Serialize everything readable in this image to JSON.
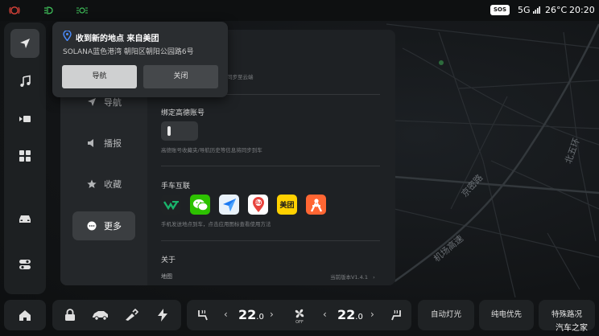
{
  "status_bar": {
    "sos": "SOS",
    "network": "5G",
    "temperature": "26°C",
    "time": "20:20"
  },
  "rail": {
    "items": [
      {
        "name": "navigation",
        "icon": "navigation-arrow-icon",
        "active": true
      },
      {
        "name": "music",
        "icon": "music-note-icon",
        "active": false
      },
      {
        "name": "video",
        "icon": "video-icon",
        "active": false
      },
      {
        "name": "apps",
        "icon": "grid-apps-icon",
        "active": false
      },
      {
        "name": "vehicle",
        "icon": "car-icon",
        "active": false
      },
      {
        "name": "controls",
        "icon": "toggle-controls-icon",
        "active": false
      }
    ]
  },
  "popup": {
    "title": "收到新的地点 来自美团",
    "address": "SOLANA蓝色港湾 朝阳区朝阳公园路6号",
    "navigate_label": "导航",
    "close_label": "关闭"
  },
  "settings": {
    "side_items": [
      {
        "label": "导航",
        "icon": "navigation-icon",
        "active": false
      },
      {
        "label": "播报",
        "icon": "speaker-icon",
        "active": false
      },
      {
        "label": "收藏",
        "icon": "star-icon",
        "active": false
      },
      {
        "label": "更多",
        "icon": "more-icon",
        "active": true
      }
    ],
    "sync_desc": "同步至云端",
    "bind_title": "绑定高德账号",
    "bind_desc": "高德账号收藏夹/导航历史等信息将同步到车",
    "phone_title": "手车互联",
    "phone_desc": "手机发送地点到车，点击应用图标查看使用方法",
    "apps": [
      {
        "name": "wecar",
        "icon": "wecar-icon",
        "label": "",
        "color": "#2c2f31"
      },
      {
        "name": "wechat",
        "icon": "wechat-icon",
        "label": "",
        "color": "#2dc100"
      },
      {
        "name": "amap",
        "icon": "amap-icon",
        "label": "",
        "color": "#e9f2fa"
      },
      {
        "name": "baidu-map",
        "icon": "baidu-map-icon",
        "label": "du",
        "color": "#ffffff"
      },
      {
        "name": "meituan",
        "icon": "meituan-icon",
        "label": "美团",
        "color": "#ffd100"
      },
      {
        "name": "dianping",
        "icon": "dianping-icon",
        "label": "",
        "color": "#ff6633"
      }
    ],
    "about_title": "关于",
    "map_label": "地图",
    "version": "当前版本V1.4.1"
  },
  "map": {
    "roads": [
      "京密路",
      "机场高速",
      "北五环"
    ]
  },
  "dock": {
    "temp_left": "22",
    "temp_left_dec": ".0",
    "temp_right": "22",
    "temp_right_dec": ".0",
    "fan_label": "OFF",
    "auto_light": "自动灯光",
    "ev_priority": "纯电优先",
    "special_road": "特殊路况"
  },
  "watermark": "汽车之家"
}
